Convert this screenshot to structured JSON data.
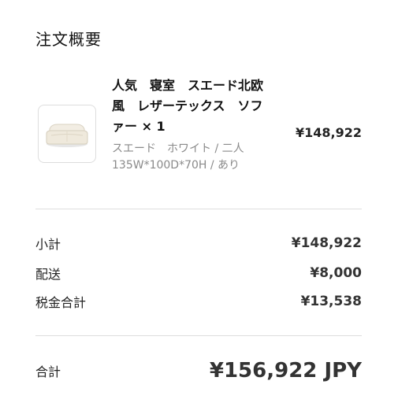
{
  "summary": {
    "title": "注文概要"
  },
  "item": {
    "name": "人気　寝室　スエード北欧風　レザーテックス　ソファー × 1",
    "variant": "スエード　ホワイト / 二人　135W*100D*70H / あり",
    "price": "¥148,922",
    "image_icon": "sofa-icon"
  },
  "totals": {
    "subtotal_label": "小計",
    "subtotal_value": "¥148,922",
    "shipping_label": "配送",
    "shipping_value": "¥8,000",
    "tax_label": "税金合計",
    "tax_value": "¥13,538",
    "total_label": "合計",
    "total_value": "¥156,922 JPY"
  },
  "colors": {
    "divider": "#dedede",
    "muted_text": "#8a8a8a",
    "sofa": "#efe9dc"
  }
}
